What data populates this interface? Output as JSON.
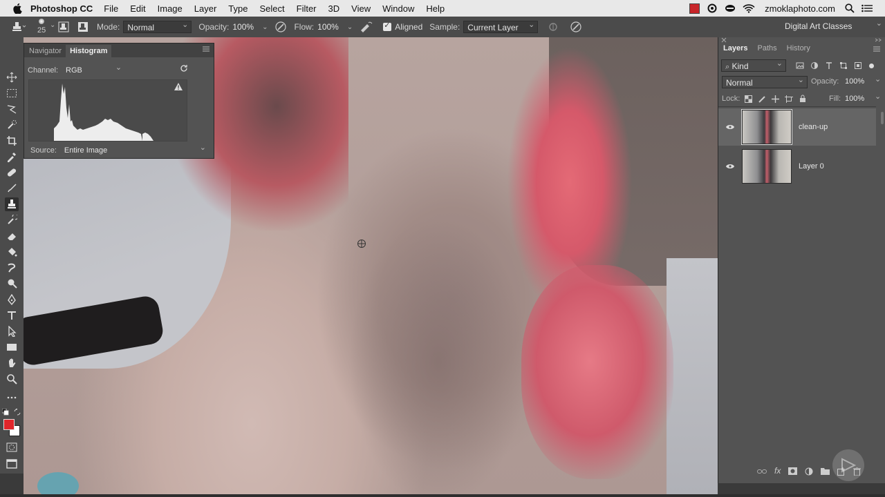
{
  "menubar": {
    "app_name": "Photoshop CC",
    "items": [
      "File",
      "Edit",
      "Image",
      "Layer",
      "Type",
      "Select",
      "Filter",
      "3D",
      "View",
      "Window",
      "Help"
    ],
    "host": "zmoklaphoto.com"
  },
  "options_bar": {
    "brush_size": "25",
    "mode_label": "Mode:",
    "mode_value": "Normal",
    "opacity_label": "Opacity:",
    "opacity_value": "100%",
    "flow_label": "Flow:",
    "flow_value": "100%",
    "aligned_label": "Aligned",
    "aligned_checked": true,
    "sample_label": "Sample:",
    "sample_value": "Current Layer",
    "workspace": "Digital Art Classes"
  },
  "histogram_panel": {
    "tabs": [
      "Navigator",
      "Histogram"
    ],
    "active_tab": "Histogram",
    "channel_label": "Channel:",
    "channel_value": "RGB",
    "source_label": "Source:",
    "source_value": "Entire Image"
  },
  "layers_panel": {
    "tabs": [
      "Layers",
      "Paths",
      "History"
    ],
    "active_tab": "Layers",
    "filter_value": "Kind",
    "blend_mode": "Normal",
    "opacity_label": "Opacity:",
    "opacity_value": "100%",
    "lock_label": "Lock:",
    "fill_label": "Fill:",
    "fill_value": "100%",
    "layers": [
      {
        "name": "clean-up",
        "selected": true
      },
      {
        "name": "Layer 0",
        "selected": false
      }
    ]
  },
  "colors": {
    "foreground": "#e0262b",
    "background": "#ffffff"
  }
}
